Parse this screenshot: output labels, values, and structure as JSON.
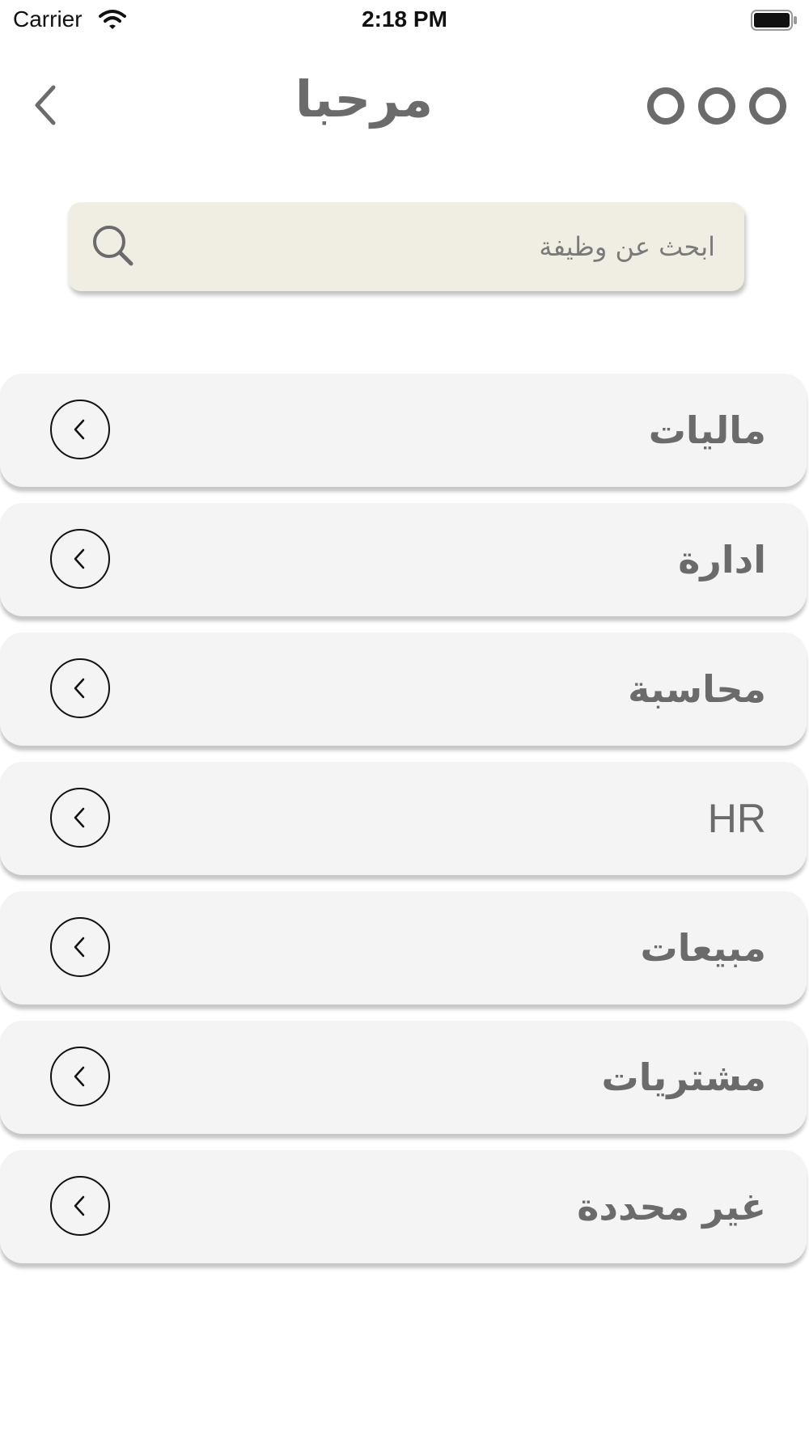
{
  "status_bar": {
    "carrier": "Carrier",
    "time": "2:18 PM"
  },
  "nav": {
    "title": "مرحبا",
    "back_icon": "chevron-left-icon",
    "more_icon": "more-dots-icon"
  },
  "search": {
    "placeholder": "ابحث عن وظيفة",
    "icon": "search-icon"
  },
  "categories": [
    {
      "label": "ماليات"
    },
    {
      "label": "ادارة"
    },
    {
      "label": "محاسبة"
    },
    {
      "label": "HR"
    },
    {
      "label": "مبيعات"
    },
    {
      "label": "مشتريات"
    },
    {
      "label": "غير محددة"
    }
  ],
  "colors": {
    "text": "#6b6b6b",
    "search_bg": "#f0ede2",
    "row_bg": "#f4f4f4"
  }
}
